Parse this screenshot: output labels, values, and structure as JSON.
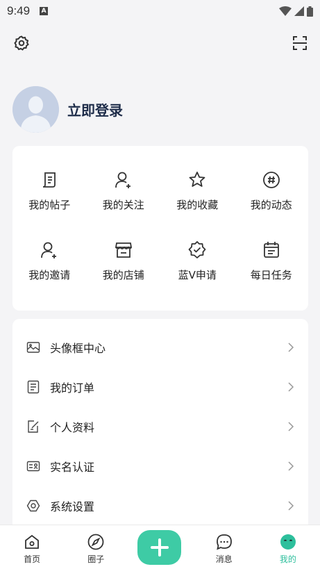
{
  "status_bar": {
    "time": "9:49",
    "badge": "A"
  },
  "profile": {
    "login_label": "立即登录"
  },
  "grid": {
    "items": [
      {
        "label": "我的帖子",
        "icon": "post-icon"
      },
      {
        "label": "我的关注",
        "icon": "follow-user-icon"
      },
      {
        "label": "我的收藏",
        "icon": "star-icon"
      },
      {
        "label": "我的动态",
        "icon": "hashtag-icon"
      },
      {
        "label": "我的邀请",
        "icon": "invite-user-icon"
      },
      {
        "label": "我的店铺",
        "icon": "shop-icon"
      },
      {
        "label": "蓝V申请",
        "icon": "verified-badge-icon"
      },
      {
        "label": "每日任务",
        "icon": "calendar-task-icon"
      }
    ]
  },
  "menu": {
    "items": [
      {
        "label": "头像框中心",
        "icon": "image-frame-icon"
      },
      {
        "label": "我的订单",
        "icon": "order-list-icon"
      },
      {
        "label": "个人资料",
        "icon": "edit-profile-icon"
      },
      {
        "label": "实名认证",
        "icon": "id-card-icon"
      },
      {
        "label": "系统设置",
        "icon": "settings-icon"
      }
    ]
  },
  "tabbar": {
    "tabs": [
      {
        "label": "首页",
        "icon": "home-icon"
      },
      {
        "label": "圈子",
        "icon": "compass-icon"
      },
      {
        "label": "消息",
        "icon": "chat-icon"
      },
      {
        "label": "我的",
        "icon": "profile-face-icon"
      }
    ],
    "active": "我的",
    "accent": "#2dbf9c"
  }
}
